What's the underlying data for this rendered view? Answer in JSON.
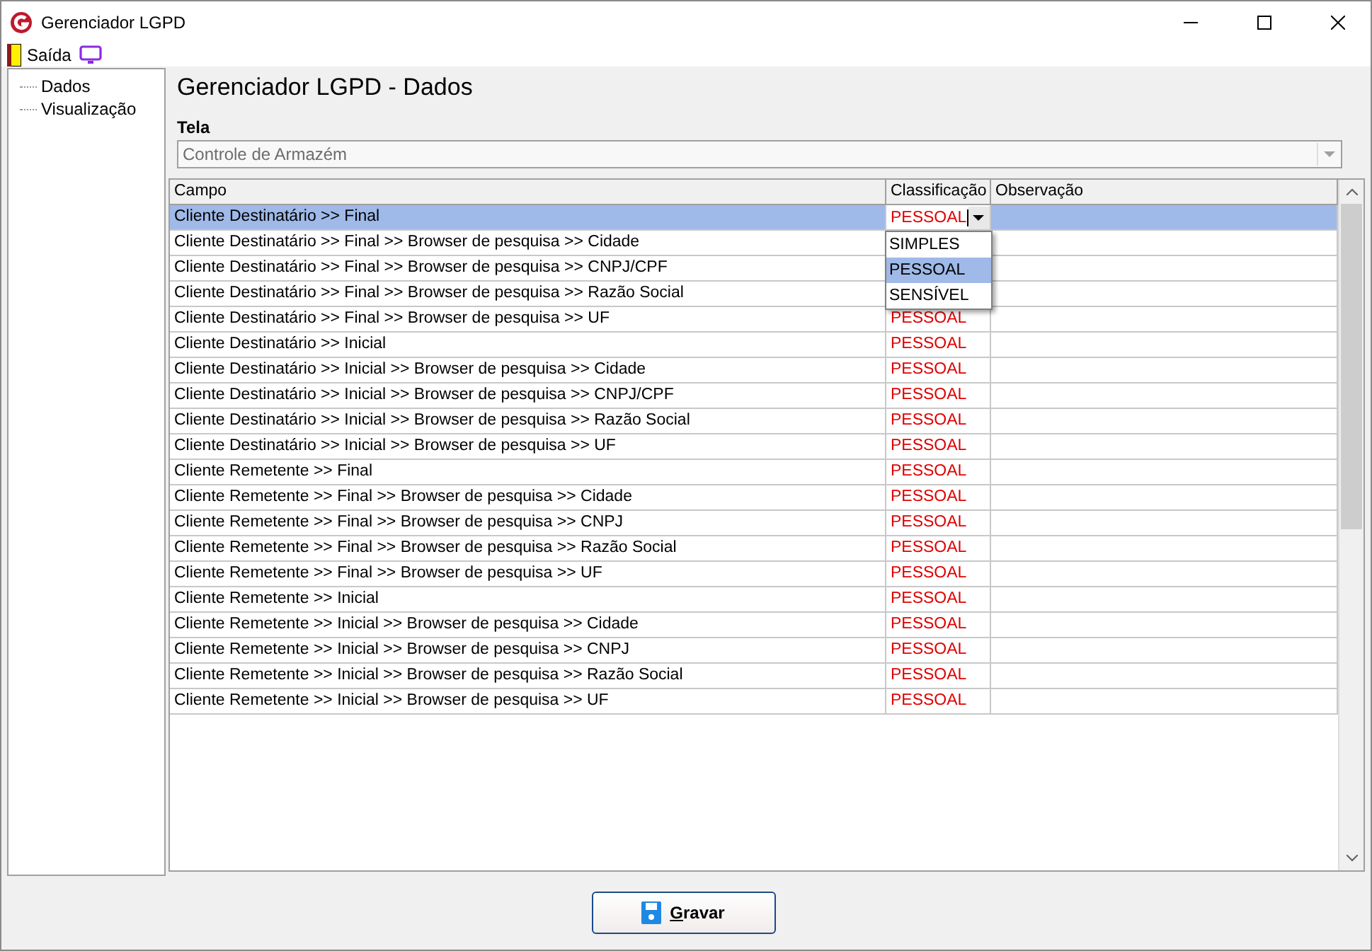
{
  "window": {
    "title": "Gerenciador LGPD"
  },
  "menu": [
    {
      "label": "Saída"
    }
  ],
  "sidebar": {
    "items": [
      {
        "label": "Dados"
      },
      {
        "label": "Visualização"
      }
    ]
  },
  "heading": "Gerenciador LGPD - Dados",
  "tela": {
    "label": "Tela",
    "value": "Controle de Armazém",
    "disabled": true
  },
  "table": {
    "columns": [
      "Campo",
      "Classificação",
      "Observação"
    ],
    "rows": [
      {
        "campo": "Cliente Destinatário >> Final",
        "classificacao": "PESSOAL",
        "selected": true
      },
      {
        "campo": "Cliente Destinatário >> Final >> Browser de pesquisa >> Cidade",
        "classificacao": "",
        "selected": false
      },
      {
        "campo": "Cliente Destinatário >> Final >> Browser de pesquisa >> CNPJ/CPF",
        "classificacao": "",
        "selected": false
      },
      {
        "campo": "Cliente Destinatário >> Final >> Browser de pesquisa >> Razão Social",
        "classificacao": "",
        "selected": false
      },
      {
        "campo": "Cliente Destinatário >> Final >> Browser de pesquisa >> UF",
        "classificacao": "PESSOAL",
        "selected": false
      },
      {
        "campo": "Cliente Destinatário >> Inicial",
        "classificacao": "PESSOAL",
        "selected": false
      },
      {
        "campo": "Cliente Destinatário >> Inicial >> Browser de pesquisa >> Cidade",
        "classificacao": "PESSOAL",
        "selected": false
      },
      {
        "campo": "Cliente Destinatário >> Inicial >> Browser de pesquisa >> CNPJ/CPF",
        "classificacao": "PESSOAL",
        "selected": false
      },
      {
        "campo": "Cliente Destinatário >> Inicial >> Browser de pesquisa >> Razão Social",
        "classificacao": "PESSOAL",
        "selected": false
      },
      {
        "campo": "Cliente Destinatário >> Inicial >> Browser de pesquisa >> UF",
        "classificacao": "PESSOAL",
        "selected": false
      },
      {
        "campo": "Cliente Remetente >> Final",
        "classificacao": "PESSOAL",
        "selected": false
      },
      {
        "campo": "Cliente Remetente >> Final >> Browser de pesquisa >> Cidade",
        "classificacao": "PESSOAL",
        "selected": false
      },
      {
        "campo": "Cliente Remetente >> Final >> Browser de pesquisa >> CNPJ",
        "classificacao": "PESSOAL",
        "selected": false
      },
      {
        "campo": "Cliente Remetente >> Final >> Browser de pesquisa >> Razão Social",
        "classificacao": "PESSOAL",
        "selected": false
      },
      {
        "campo": "Cliente Remetente >> Final >> Browser de pesquisa >> UF",
        "classificacao": "PESSOAL",
        "selected": false
      },
      {
        "campo": "Cliente Remetente >> Inicial",
        "classificacao": "PESSOAL",
        "selected": false
      },
      {
        "campo": "Cliente Remetente >> Inicial >> Browser de pesquisa >> Cidade",
        "classificacao": "PESSOAL",
        "selected": false
      },
      {
        "campo": "Cliente Remetente >> Inicial >> Browser de pesquisa >> CNPJ",
        "classificacao": "PESSOAL",
        "selected": false
      },
      {
        "campo": "Cliente Remetente >> Inicial >> Browser de pesquisa >> Razão Social",
        "classificacao": "PESSOAL",
        "selected": false
      },
      {
        "campo": "Cliente Remetente >> Inicial >> Browser de pesquisa >> UF",
        "classificacao": "PESSOAL",
        "selected": false
      }
    ]
  },
  "dropdown": {
    "options": [
      {
        "label": "SIMPLES",
        "selected": false
      },
      {
        "label": "PESSOAL",
        "selected": true
      },
      {
        "label": "SENSÍVEL",
        "selected": false
      }
    ]
  },
  "buttons": [
    {
      "label": "Gravar"
    }
  ]
}
